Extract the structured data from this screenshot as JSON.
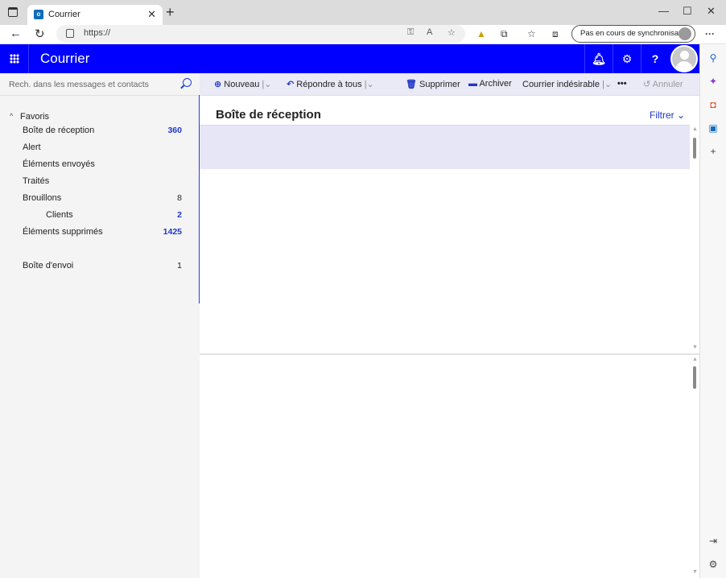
{
  "browser": {
    "tab_title": "Courrier",
    "tab_favicon_letter": "o",
    "url": "https://",
    "sync_label": "Pas en cours de synchronisation"
  },
  "header": {
    "app_title": "Courrier",
    "color": "#0000ff"
  },
  "search": {
    "placeholder": "Rech. dans les messages et contacts"
  },
  "commands": {
    "new": "Nouveau",
    "reply_all": "Répondre à tous",
    "delete": "Supprimer",
    "archive": "Archiver",
    "junk": "Courrier indésirable",
    "more": "•••",
    "undo": "Annuler"
  },
  "folders": {
    "favorites_label": "Favoris",
    "items": [
      {
        "label": "Boîte de réception",
        "count": "360",
        "unread": true
      },
      {
        "label": "Alert",
        "count": "",
        "unread": false
      },
      {
        "label": "Éléments envoyés",
        "count": "",
        "unread": false
      },
      {
        "label": "Traités",
        "count": "",
        "unread": false
      },
      {
        "label": "Brouillons",
        "count": "8",
        "unread": false
      },
      {
        "label": "Clients",
        "count": "2",
        "unread": true
      },
      {
        "label": "Éléments supprimés",
        "count": "1425",
        "unread": true
      },
      {
        "label": "Boîte d'envoi",
        "count": "1",
        "unread": false
      }
    ]
  },
  "message_list": {
    "title": "Boîte de réception",
    "filter_label": "Filtrer"
  },
  "accent_color": "#1f36c7"
}
